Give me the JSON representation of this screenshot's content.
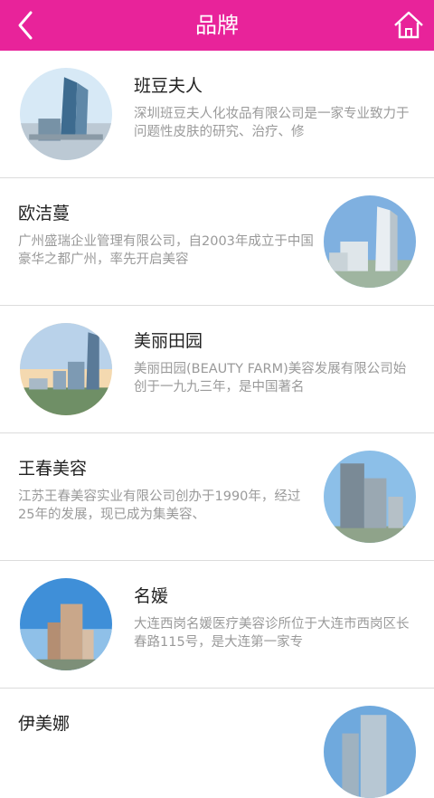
{
  "header": {
    "title": "品牌",
    "back_icon": "back-arrow-icon",
    "home_icon": "home-icon",
    "background": "#e8239a"
  },
  "items": [
    {
      "name": "班豆夫人",
      "desc": "深圳班豆夫人化妆品有限公司是一家专业致力于问题性皮肤的研究、治疗、修"
    },
    {
      "name": "欧洁蔓",
      "desc": "广州盛瑞企业管理有限公司，自2003年成立于中国豪华之都广州，率先开启美容"
    },
    {
      "name": "美丽田园",
      "desc": "美丽田园(BEAUTY FARM)美容发展有限公司始创于一九九三年，是中国著名"
    },
    {
      "name": "王春美容",
      "desc": "江苏王春美容实业有限公司创办于1990年，经过25年的发展，现已成为集美容、"
    },
    {
      "name": "名媛",
      "desc": "大连西岗名媛医疗美容诊所位于大连市西岗区长春路115号，是大连第一家专"
    },
    {
      "name": "伊美娜",
      "desc": ""
    }
  ]
}
